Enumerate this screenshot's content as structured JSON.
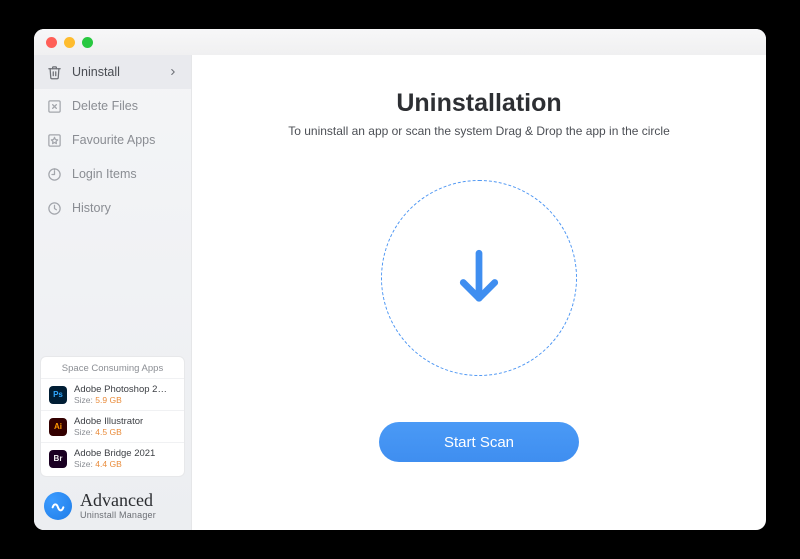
{
  "sidebar": {
    "items": [
      {
        "label": "Uninstall",
        "icon": "trash-icon",
        "active": true
      },
      {
        "label": "Delete Files",
        "icon": "delete-files-icon",
        "active": false
      },
      {
        "label": "Favourite Apps",
        "icon": "favourite-icon",
        "active": false
      },
      {
        "label": "Login Items",
        "icon": "login-items-icon",
        "active": false
      },
      {
        "label": "History",
        "icon": "history-icon",
        "active": false
      }
    ]
  },
  "space_card": {
    "title": "Space Consuming Apps",
    "size_prefix": "Size:",
    "apps": [
      {
        "name": "Adobe Photoshop 2…",
        "size": "5.9 GB",
        "icon_label": "Ps",
        "icon_class": "ps"
      },
      {
        "name": "Adobe Illustrator",
        "size": "4.5 GB",
        "icon_label": "Ai",
        "icon_class": "ai"
      },
      {
        "name": "Adobe Bridge 2021",
        "size": "4.4 GB",
        "icon_label": "Br",
        "icon_class": "br"
      }
    ]
  },
  "brand": {
    "title": "Advanced",
    "subtitle": "Uninstall Manager"
  },
  "main": {
    "title": "Uninstallation",
    "subtitle": "To uninstall an app or scan the system Drag & Drop the app in the circle",
    "scan_button": "Start Scan"
  },
  "colors": {
    "accent": "#4a97f4"
  }
}
